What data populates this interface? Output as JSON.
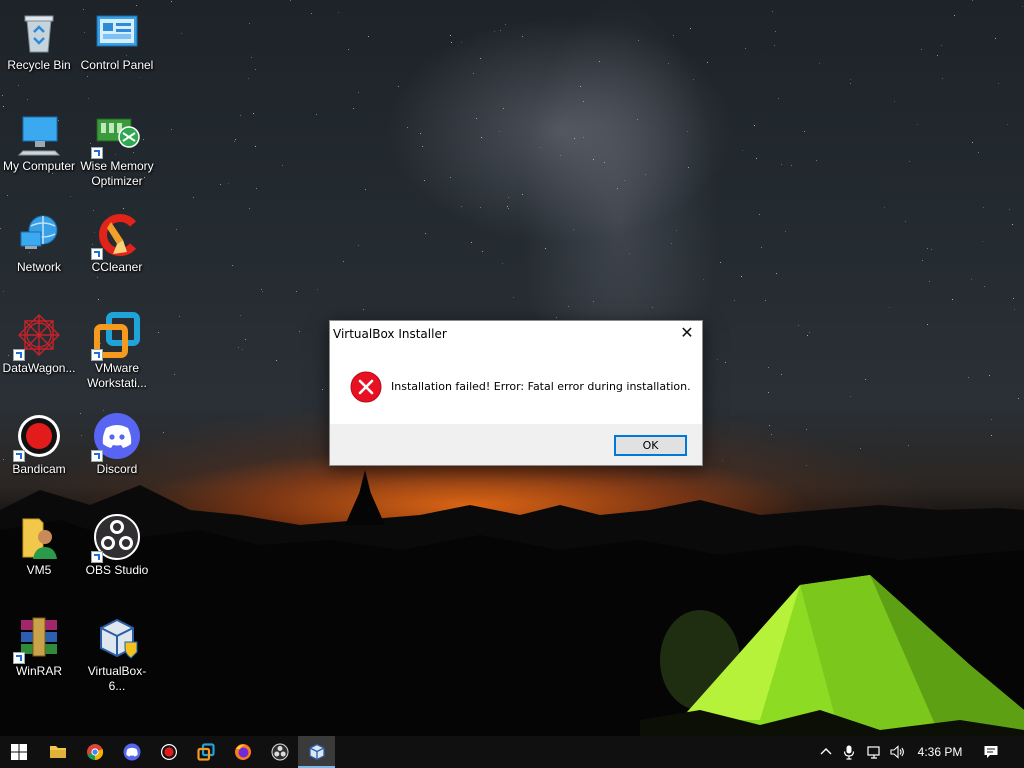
{
  "desktop": {
    "icons": [
      {
        "label": "Recycle Bin",
        "icon": "recycle-bin-icon"
      },
      {
        "label": "Control Panel",
        "icon": "control-panel-icon"
      },
      {
        "label": "My Computer",
        "icon": "computer-icon"
      },
      {
        "label": "Wise Memory Optimizer",
        "icon": "memory-optimizer-icon"
      },
      {
        "label": "Network",
        "icon": "network-icon"
      },
      {
        "label": "CCleaner",
        "icon": "ccleaner-icon"
      },
      {
        "label": "DataWagon...",
        "icon": "datawagon-icon"
      },
      {
        "label": "VMware Workstati...",
        "icon": "vmware-icon"
      },
      {
        "label": "Bandicam",
        "icon": "bandicam-icon"
      },
      {
        "label": "Discord",
        "icon": "discord-icon"
      },
      {
        "label": "VM5",
        "icon": "folder-user-icon"
      },
      {
        "label": "OBS Studio",
        "icon": "obs-icon"
      },
      {
        "label": "WinRAR",
        "icon": "winrar-icon"
      },
      {
        "label": "VirtualBox-6...",
        "icon": "virtualbox-installer-icon"
      }
    ]
  },
  "dialog": {
    "title": "VirtualBox Installer",
    "close_symbol": "✕",
    "message": "Installation failed! Error: Fatal error during installation.",
    "ok_label": "OK",
    "icon": "error-icon"
  },
  "taskbar": {
    "items": [
      {
        "name": "start-button",
        "icon": "windows-logo-icon"
      },
      {
        "name": "file-explorer",
        "icon": "folder-icon"
      },
      {
        "name": "chrome",
        "icon": "chrome-icon"
      },
      {
        "name": "discord",
        "icon": "discord-icon"
      },
      {
        "name": "bandicam",
        "icon": "record-icon"
      },
      {
        "name": "vmware",
        "icon": "vmware-icon"
      },
      {
        "name": "firefox",
        "icon": "firefox-icon"
      },
      {
        "name": "obs",
        "icon": "obs-icon"
      },
      {
        "name": "virtualbox",
        "icon": "virtualbox-icon",
        "active": true
      }
    ],
    "tray": {
      "chevron": "^",
      "time": "4:36 PM"
    }
  },
  "colors": {
    "accent": "#0078d7",
    "error": "#e81123",
    "taskbar": "#101010"
  }
}
